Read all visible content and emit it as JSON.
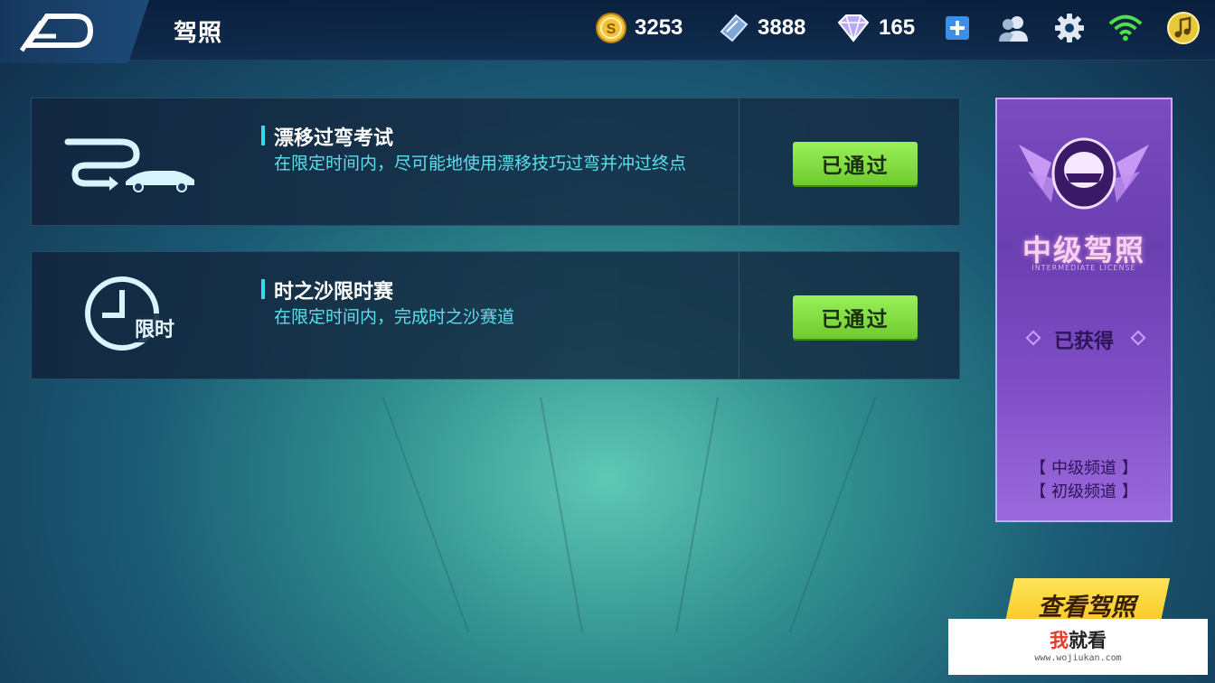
{
  "header": {
    "title": "驾照",
    "gold_coins": "3253",
    "tickets": "3888",
    "diamonds": "165"
  },
  "tests": [
    {
      "title": "漂移过弯考试",
      "description": "在限定时间内，尽可能地使用漂移技巧过弯并冲过终点",
      "status": "已通过",
      "icon": "drift-car-icon"
    },
    {
      "title": "时之沙限时赛",
      "description": "在限定时间内，完成时之沙赛道",
      "status": "已通过",
      "icon": "timed-race-icon",
      "icon_text": "限时"
    }
  ],
  "license": {
    "title": "中级驾照",
    "subtitle": "INTERMEDIATE LICENSE",
    "status": "已获得",
    "channels": [
      "【 中级频道 】",
      "【 初级频道 】"
    ]
  },
  "view_button": "查看驾照",
  "watermark": {
    "brand_red": "我",
    "brand_rest": "就看",
    "url": "www.wojiukan.com"
  },
  "colors": {
    "accent_cyan": "#3fd6f0",
    "pass_green": "#7ed93f",
    "license_purple": "#7a4bbf",
    "view_yellow": "#f5c51c"
  }
}
